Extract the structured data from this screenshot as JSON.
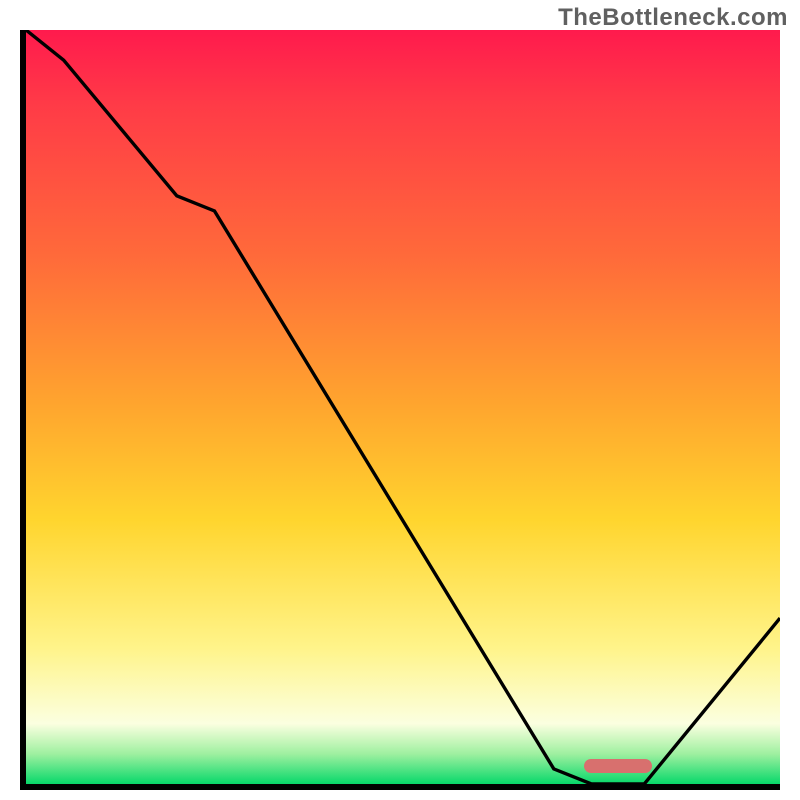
{
  "attribution": "TheBottleneck.com",
  "chart_data": {
    "type": "line",
    "title": "",
    "xlabel": "",
    "ylabel": "",
    "xlim": [
      0,
      100
    ],
    "ylim": [
      0,
      100
    ],
    "x": [
      0,
      5,
      20,
      25,
      70,
      75,
      82,
      100
    ],
    "values": [
      100,
      96,
      78,
      76,
      2,
      0,
      0,
      22
    ],
    "marker": {
      "x_start": 74,
      "x_end": 83,
      "y": 1.5
    },
    "gradient_stops": [
      {
        "pos": 0,
        "color": "#ff1a4d"
      },
      {
        "pos": 10,
        "color": "#ff3b47"
      },
      {
        "pos": 30,
        "color": "#ff6a3a"
      },
      {
        "pos": 50,
        "color": "#ffa62e"
      },
      {
        "pos": 65,
        "color": "#ffd52e"
      },
      {
        "pos": 82,
        "color": "#fff48a"
      },
      {
        "pos": 92,
        "color": "#fbffe0"
      },
      {
        "pos": 96,
        "color": "#9ff0a0"
      },
      {
        "pos": 100,
        "color": "#08d86a"
      }
    ]
  }
}
